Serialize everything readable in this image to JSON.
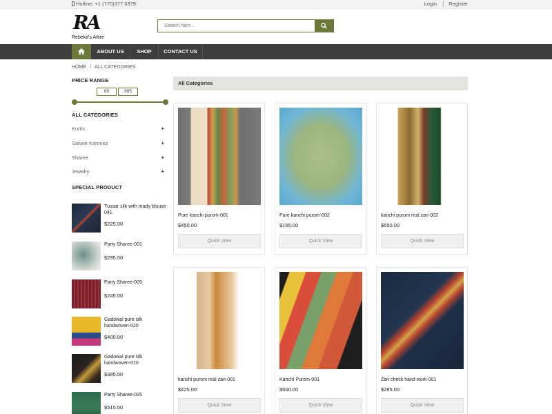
{
  "topbar": {
    "hotline": "Hotline: +1 (770)377 6379",
    "login": "Login",
    "register": "Register"
  },
  "logo": {
    "mark": "RA",
    "name": "Rebeka's Attire"
  },
  "search": {
    "placeholder": "Search here..."
  },
  "nav": {
    "about": "ABOUT US",
    "shop": "SHOP",
    "contact": "CONTACT US"
  },
  "breadcrumb": {
    "home": "HOME",
    "current": "ALL CATEGORIES",
    "separator": "/"
  },
  "sidebar": {
    "price_range_title": "PRICE RANGE",
    "price_min": "80",
    "price_max": "995",
    "categories_title": "ALL CATEGORIES",
    "categories": [
      "Kurtis",
      "Salwar Kameez",
      "Sharee",
      "Jewelry"
    ],
    "special_title": "SPECIAL PRODUCT",
    "special_products": [
      {
        "name": "Tussar silk with ready blouse-041",
        "price": "$225.00"
      },
      {
        "name": "Party Sharee-001",
        "price": "$295.00"
      },
      {
        "name": "Party Sharee-009",
        "price": "$245.00"
      },
      {
        "name": "Gadowal pure silk handwoven-020",
        "price": "$400.00"
      },
      {
        "name": "Gadowal pure silk handwoven-010",
        "price": "$385.00"
      },
      {
        "name": "Party Sharee-025",
        "price": "$515.00"
      }
    ]
  },
  "main": {
    "header": "All Categories",
    "quick_view_label": "Quick View",
    "products": [
      {
        "name": "Pure kanchi purom-001",
        "price": "$450.00"
      },
      {
        "name": "Pure kanchi purom-002",
        "price": "$165.00"
      },
      {
        "name": "kanchi purom real zari-002",
        "price": "$650.00"
      },
      {
        "name": "kanchi purom real zari-001",
        "price": "$425.00"
      },
      {
        "name": "Kanchi Purom-001",
        "price": "$500.00"
      },
      {
        "name": "Zari check hand work-001",
        "price": "$285.00"
      }
    ]
  },
  "colors": {
    "accent": "#6b7a3c",
    "nav_bg": "#3e3e3e",
    "header_bg": "#e4e4de"
  },
  "icons": {
    "home": "home-icon",
    "search": "search-icon",
    "phone": "phone-icon",
    "expand": "plus-icon"
  }
}
